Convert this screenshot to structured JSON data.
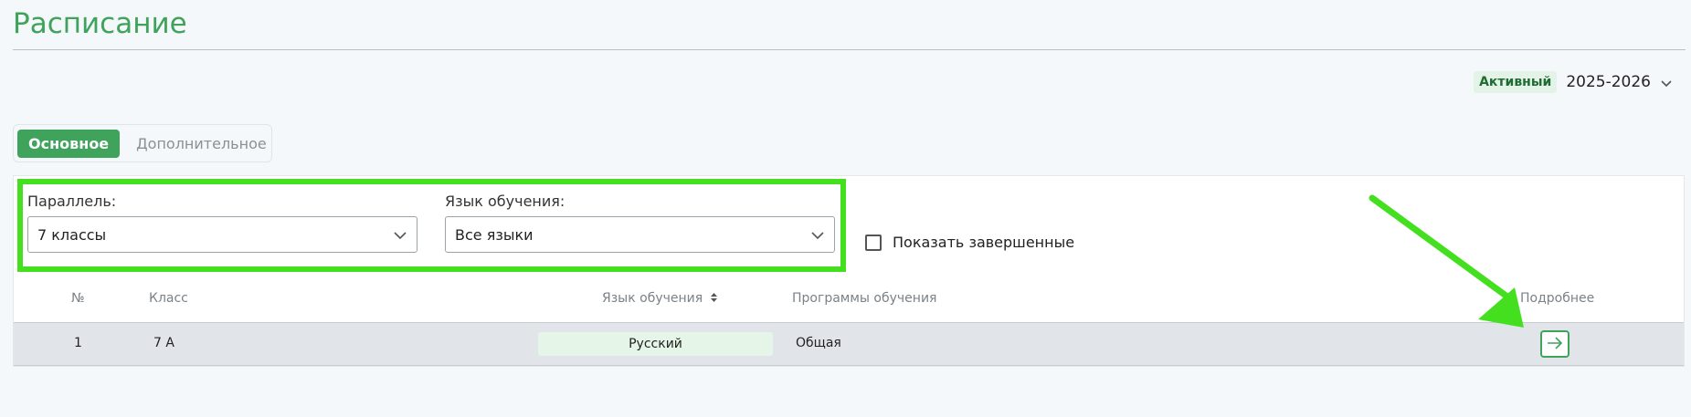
{
  "page": {
    "title": "Расписание"
  },
  "year_selector": {
    "status": "Активный",
    "year": "2025-2026"
  },
  "tabs": [
    {
      "label": "Основное",
      "active": true
    },
    {
      "label": "Дополнительное",
      "active": false
    }
  ],
  "filters": {
    "parallel": {
      "label": "Параллель:",
      "value": "7 классы"
    },
    "language": {
      "label": "Язык обучения:",
      "value": "Все языки"
    },
    "show_completed": {
      "label": "Показать завершенные",
      "checked": false
    }
  },
  "table": {
    "headers": {
      "num": "№",
      "class": "Класс",
      "language": "Язык обучения",
      "programs": "Программы обучения",
      "details": "Подробнее"
    },
    "rows": [
      {
        "num": "1",
        "class": "7 А",
        "language": "Русский",
        "program": "Общая"
      }
    ]
  },
  "colors": {
    "accent": "#3fa35c",
    "annotation": "#44e01f"
  }
}
